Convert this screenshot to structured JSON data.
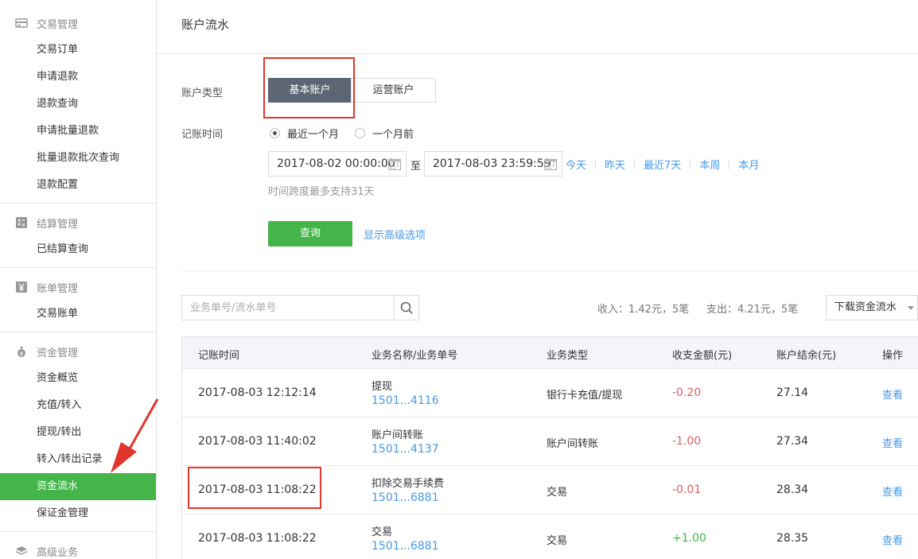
{
  "sidebar": {
    "sections": [
      {
        "title": "交易管理",
        "icon": "card-icon",
        "items": [
          "交易订单",
          "申请退款",
          "退款查询",
          "申请批量退款",
          "批量退款批次查询",
          "退款配置"
        ]
      },
      {
        "title": "结算管理",
        "icon": "calculator-icon",
        "items": [
          "已结算查询"
        ]
      },
      {
        "title": "账单管理",
        "icon": "yen-icon",
        "items": [
          "交易账单"
        ]
      },
      {
        "title": "资金管理",
        "icon": "moneybag-icon",
        "items": [
          "资金概览",
          "充值/转入",
          "提现/转出",
          "转入/转出记录",
          "资金流水",
          "保证金管理"
        ]
      },
      {
        "title": "高级业务",
        "icon": "layers-icon",
        "items": []
      }
    ],
    "active_item": "资金流水"
  },
  "page": {
    "title": "账户流水"
  },
  "filters": {
    "account_type_label": "账户类型",
    "account_types": [
      "基本账户",
      "运营账户"
    ],
    "selected_account_type": "基本账户",
    "time_label": "记账时间",
    "radio_options": [
      "最近一个月",
      "一个月前"
    ],
    "selected_radio": "最近一个月",
    "start_time": "2017-08-02 00:00:00",
    "to": "至",
    "end_time": "2017-08-03 23:59:59",
    "quick_ranges": [
      "今天",
      "昨天",
      "最近7天",
      "本周",
      "本月"
    ],
    "hint": "时间跨度最多支持31天",
    "query_button": "查询",
    "advanced_link": "显示高级选项"
  },
  "search": {
    "placeholder": "业务单号/流水单号"
  },
  "summary": {
    "income": "收入：1.42元，5笔",
    "expense": "支出：4.21元，5笔"
  },
  "download": {
    "label": "下载资金流水"
  },
  "table": {
    "headers": [
      "记账时间",
      "业务名称/业务单号",
      "业务类型",
      "收支金额(元)",
      "账户结余(元)",
      "操作"
    ],
    "rows": [
      {
        "time": "2017-08-03 12:12:14",
        "name": "提现",
        "order": "1501...4116",
        "type": "银行卡充值/提现",
        "amount": "-0.20",
        "sign": "neg",
        "balance": "27.14",
        "action": "查看"
      },
      {
        "time": "2017-08-03 11:40:02",
        "name": "账户间转账",
        "order": "1501...4137",
        "type": "账户间转账",
        "amount": "-1.00",
        "sign": "neg",
        "balance": "27.34",
        "action": "查看"
      },
      {
        "time": "2017-08-03 11:08:22",
        "name": "扣除交易手续费",
        "order": "1501...6881",
        "type": "交易",
        "amount": "-0.01",
        "sign": "neg",
        "balance": "28.34",
        "action": "查看"
      },
      {
        "time": "2017-08-03 11:08:22",
        "name": "交易",
        "order": "1501...6881",
        "type": "交易",
        "amount": "+1.00",
        "sign": "pos",
        "balance": "28.35",
        "action": "查看"
      }
    ]
  },
  "colors": {
    "accent_green": "#44b549",
    "link_blue": "#459ae9",
    "negative_red": "#e15f63",
    "annotation_red": "#e0362e",
    "selected_segment": "#5c6574"
  }
}
